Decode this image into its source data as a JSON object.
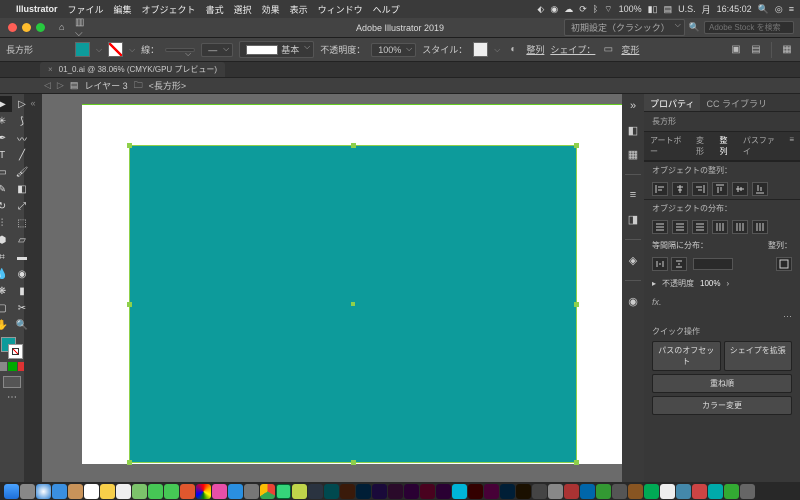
{
  "mac_menu": {
    "app": "Illustrator",
    "items": [
      "ファイル",
      "編集",
      "オブジェクト",
      "書式",
      "選択",
      "効果",
      "表示",
      "ウィンドウ",
      "ヘルプ"
    ],
    "status": {
      "wifi": "100%",
      "locale": "U.S.",
      "day": "月",
      "time": "16:45:02"
    }
  },
  "titlebar": {
    "title": "Adobe Illustrator 2019",
    "preset_label": "初期設定（クラシック）",
    "search_placeholder": "Adobe Stock を検索"
  },
  "ctrl": {
    "shape_name": "長方形",
    "stroke_label": "線：",
    "stroke_width": "",
    "stroke_style": "基本",
    "opacity_label": "不透明度：",
    "opacity_value": "100%",
    "style_label": "スタイル：",
    "align_label": "整列",
    "shape_btn": "シェイプ：",
    "transform_label": "変形"
  },
  "doc_tab": {
    "label": "01_0.ai @ 38.06% (CMYK/GPU プレビュー)"
  },
  "layer_path": {
    "layer": "レイヤー 3",
    "object": "<長方形>"
  },
  "ppanel": {
    "tab_props": "プロパティ",
    "tab_cclib": "CC ライブラリ",
    "shape": "長方形",
    "tabs2": [
      "アートボー",
      "変形",
      "整列",
      "パスファイ"
    ],
    "align_obj_hdr": "オブジェクトの整列：",
    "dist_obj_hdr": "オブジェクトの分布：",
    "equal_spacing": "等間隔に分布：",
    "align_to": "整列：",
    "opacity_label": "不透明度",
    "opacity_value": "100%",
    "fx": "fx.",
    "quick_hdr": "クイック操作",
    "btn_offset": "パスのオフセット",
    "btn_expand": "シェイプを拡張",
    "btn_arrange": "重ね順",
    "btn_recolor": "カラー変更"
  },
  "canvas": {
    "fill": "#0d9b9b"
  }
}
